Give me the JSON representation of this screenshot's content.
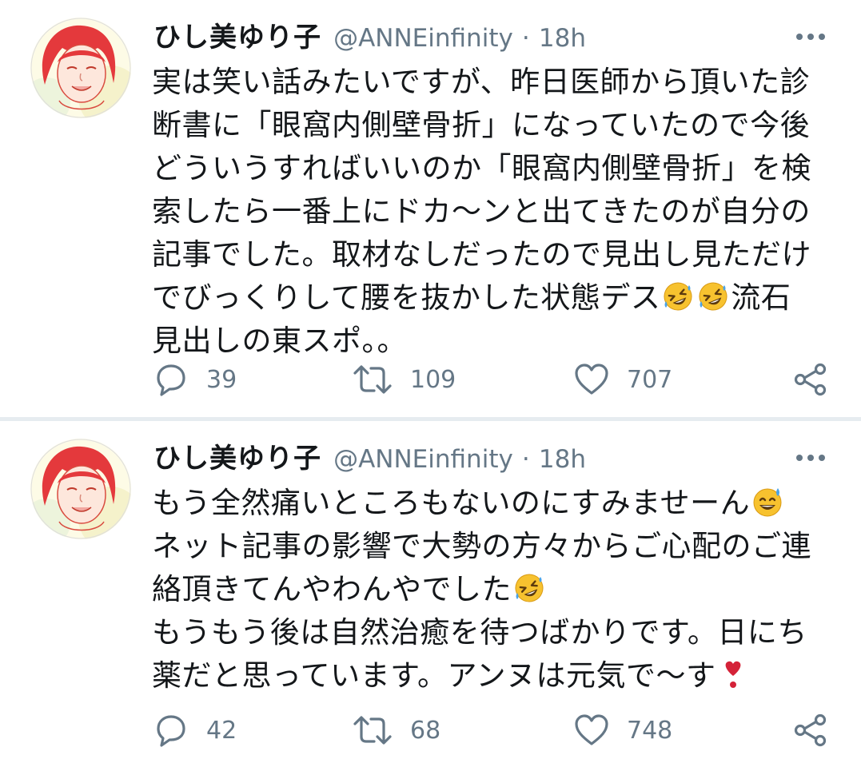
{
  "colors": {
    "text": "#14171a",
    "secondary": "#657786",
    "separator": "#e6ecf0"
  },
  "tweets": [
    {
      "author_name": "ひし美ゆり子",
      "handle": "@ANNEinfinity",
      "separator": "·",
      "time": "18h",
      "lines": [
        "実は笑い話みたいですが、昨日医師から頂いた診",
        "断書に「眼窩内側壁骨折」になっていたので今後",
        "どういうすればいいのか「眼窩内側壁骨折」を検",
        "索したら一番上にドカ〜ンと出てきたのが自分の",
        "記事でした。取材なしだったので見出し見ただけ",
        "でびっくりして腰を抜かした状態デス",
        "流石",
        "見出しの東スポ。。"
      ],
      "emojis": [
        "rolling-on-floor-laughing-emoji",
        "rolling-on-floor-laughing-emoji"
      ],
      "replies": "39",
      "retweets": "109",
      "likes": "707"
    },
    {
      "author_name": "ひし美ゆり子",
      "handle": "@ANNEinfinity",
      "separator": "·",
      "time": "18h",
      "lines": [
        "もう全然痛いところもないのにすみませーん",
        "ネット記事の影響で大勢の方々からご心配のご連",
        "絡頂きてんやわんやでした",
        "もうもう後は自然治癒を待つばかりです。日にち",
        "薬だと思っています。アンヌは元気で〜す"
      ],
      "emojis": [
        "grinning-sweat-emoji",
        "rolling-on-floor-laughing-emoji",
        "heavy-heart-exclamation-emoji"
      ],
      "replies": "42",
      "retweets": "68",
      "likes": "748"
    }
  ],
  "icons": {
    "more": "more-horizontal-icon",
    "reply": "reply-bubble-icon",
    "retweet": "retweet-arrows-icon",
    "like": "heart-outline-icon",
    "share": "share-nodes-icon"
  }
}
